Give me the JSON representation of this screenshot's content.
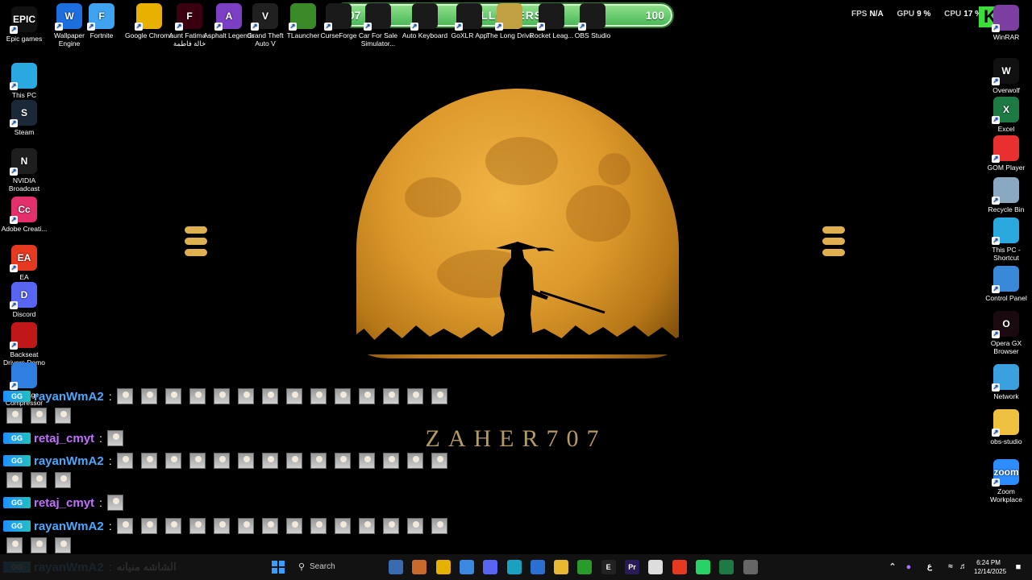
{
  "followers": {
    "current": "107",
    "label": "FOLLOWERS",
    "goal": "100"
  },
  "perf": {
    "fps_label": "FPS",
    "fps_value": "N/A",
    "gpu_label": "GPU",
    "gpu_value": "9 %",
    "cpu_label": "CPU",
    "cpu_value": "17 %",
    "overlay_number": "9"
  },
  "wallpaper": {
    "brand": "ZAHER707"
  },
  "desktop_icons_left": [
    {
      "label": "Epic games",
      "icon": "epic-games-icon",
      "color": "#111111",
      "glyph": "EPIC"
    },
    {
      "label": "This PC",
      "icon": "monitor-icon",
      "color": "#29a9e0",
      "glyph": ""
    },
    {
      "label": "Steam",
      "icon": "steam-icon",
      "color": "#1b2838",
      "glyph": "S"
    },
    {
      "label": "NVIDIA Broadcast",
      "icon": "nvidia-icon",
      "color": "#1e1e1e",
      "glyph": "N"
    },
    {
      "label": "Adobe Creati...",
      "icon": "adobe-cc-icon",
      "color": "#e2306c",
      "glyph": "Cc"
    },
    {
      "label": "EA",
      "icon": "ea-icon",
      "color": "#e53920",
      "glyph": "EA"
    },
    {
      "label": "Discord",
      "icon": "discord-icon",
      "color": "#5865f2",
      "glyph": "D"
    },
    {
      "label": "Backseat Drivers Demo",
      "icon": "car-icon",
      "color": "#c01818",
      "glyph": ""
    },
    {
      "label": "4K Image Compressor",
      "icon": "compressor-icon",
      "color": "#2f7fe0",
      "glyph": ""
    }
  ],
  "desktop_icons_top": [
    {
      "label": "Wallpaper Engine",
      "icon": "wallpaper-engine-icon",
      "color": "#1d6fe0",
      "glyph": "W"
    },
    {
      "label": "Fortnite",
      "icon": "fortnite-icon",
      "color": "#3fa3f0",
      "glyph": "F"
    },
    {
      "label": "Google Chrome",
      "icon": "chrome-icon",
      "color": "#e8b000",
      "glyph": ""
    },
    {
      "label": "Aunt Fatima - خالة فاطمة",
      "icon": "aunt-fatima-icon",
      "color": "#3a0010",
      "glyph": "F"
    },
    {
      "label": "Asphalt Legends",
      "icon": "asphalt-icon",
      "color": "#7b3fc4",
      "glyph": "A"
    },
    {
      "label": "Grand Theft Auto V",
      "icon": "gta-icon",
      "color": "#202020",
      "glyph": "V"
    },
    {
      "label": "TLauncher",
      "icon": "tlauncher-icon",
      "color": "#3a8a2a",
      "glyph": ""
    },
    {
      "label": "CurseForge",
      "icon": "curseforge-icon",
      "color": "#1a1a1a",
      "glyph": ""
    },
    {
      "label": "Car For Sale Simulator...",
      "icon": "car-for-sale-icon",
      "color": "#1a1a1a",
      "glyph": ""
    },
    {
      "label": "Auto Keyboard",
      "icon": "auto-keyboard-icon",
      "color": "#1a1a1a",
      "glyph": ""
    },
    {
      "label": "GoXLR App",
      "icon": "goxlr-icon",
      "color": "#1a1a1a",
      "glyph": ""
    },
    {
      "label": "The Long Drive",
      "icon": "long-drive-icon",
      "color": "#c0a040",
      "glyph": ""
    },
    {
      "label": "Rocket Leag...",
      "icon": "rocket-league-icon",
      "color": "#1a1a1a",
      "glyph": ""
    },
    {
      "label": "OBS Studio",
      "icon": "obs-icon",
      "color": "#1a1a1a",
      "glyph": ""
    }
  ],
  "desktop_icons_right": [
    {
      "label": "WinRAR",
      "icon": "winrar-icon",
      "color": "#7a3fa0",
      "glyph": ""
    },
    {
      "label": "Overwolf",
      "icon": "overwolf-icon",
      "color": "#111111",
      "glyph": "W"
    },
    {
      "label": "Excel",
      "icon": "excel-icon",
      "color": "#1d7a42",
      "glyph": "X"
    },
    {
      "label": "GOM Player",
      "icon": "gom-player-icon",
      "color": "#e83030",
      "glyph": ""
    },
    {
      "label": "Recycle Bin",
      "icon": "recycle-bin-icon",
      "color": "#8aa8c0",
      "glyph": ""
    },
    {
      "label": "This PC - Shortcut",
      "icon": "monitor-icon",
      "color": "#29a9e0",
      "glyph": ""
    },
    {
      "label": "Control Panel",
      "icon": "control-panel-icon",
      "color": "#3a88d8",
      "glyph": ""
    },
    {
      "label": "Opera GX Browser",
      "icon": "opera-gx-icon",
      "color": "#1a0a10",
      "glyph": "O"
    },
    {
      "label": "Network",
      "icon": "network-icon",
      "color": "#3aa0e0",
      "glyph": ""
    },
    {
      "label": "obs-studio",
      "icon": "folder-icon",
      "color": "#f0c040",
      "glyph": ""
    },
    {
      "label": "Zoom Workplace",
      "icon": "zoom-icon",
      "color": "#2d8cff",
      "glyph": "zoom"
    }
  ],
  "chat": {
    "badge": "GG",
    "separator": ":",
    "lines": [
      {
        "user": "rayanWmA2",
        "color": "#4aa8ff",
        "emotes": 14,
        "extra": 3
      },
      {
        "user": "retaj_cmyt",
        "color": "#c070ff",
        "emotes": 1,
        "extra": 0
      },
      {
        "user": "rayanWmA2",
        "color": "#4aa8ff",
        "emotes": 14,
        "extra": 3
      },
      {
        "user": "retaj_cmyt",
        "color": "#c070ff",
        "emotes": 1,
        "extra": 0
      },
      {
        "user": "rayanWmA2",
        "color": "#4aa8ff",
        "emotes": 14,
        "extra": 3
      },
      {
        "user": "rayanWmA2",
        "color": "#4aa8ff",
        "text": "الشاشه منيانه",
        "emotes": 0,
        "extra": 0
      }
    ]
  },
  "taskbar": {
    "search_placeholder": "Search",
    "pinned": [
      {
        "icon": "widgets-icon",
        "color": "#3a6ab0",
        "glyph": ""
      },
      {
        "icon": "app-icon",
        "color": "#c86a2a",
        "glyph": ""
      },
      {
        "icon": "chrome-icon",
        "color": "#e8b000",
        "glyph": ""
      },
      {
        "icon": "app-icon",
        "color": "#3a88e0",
        "glyph": ""
      },
      {
        "icon": "discord-icon",
        "color": "#5865f2",
        "glyph": ""
      },
      {
        "icon": "edge-icon",
        "color": "#1aa0c0",
        "glyph": ""
      },
      {
        "icon": "store-icon",
        "color": "#2a70d0",
        "glyph": ""
      },
      {
        "icon": "file-explorer-icon",
        "color": "#e8b830",
        "glyph": ""
      },
      {
        "icon": "xbox-icon",
        "color": "#2a9a2a",
        "glyph": ""
      },
      {
        "icon": "epic-games-icon",
        "color": "#222222",
        "glyph": "E"
      },
      {
        "icon": "premiere-icon",
        "color": "#2a1a5a",
        "glyph": "Pr"
      },
      {
        "icon": "file-icon",
        "color": "#dddddd",
        "glyph": ""
      },
      {
        "icon": "ea-icon",
        "color": "#e53920",
        "glyph": ""
      },
      {
        "icon": "whatsapp-icon",
        "color": "#25d366",
        "glyph": ""
      },
      {
        "icon": "excel-icon",
        "color": "#1d7a42",
        "glyph": ""
      },
      {
        "icon": "app-icon",
        "color": "#666666",
        "glyph": ""
      }
    ],
    "tray_lang": "ع",
    "time": "6:24 PM",
    "date": "12/14/2025"
  }
}
